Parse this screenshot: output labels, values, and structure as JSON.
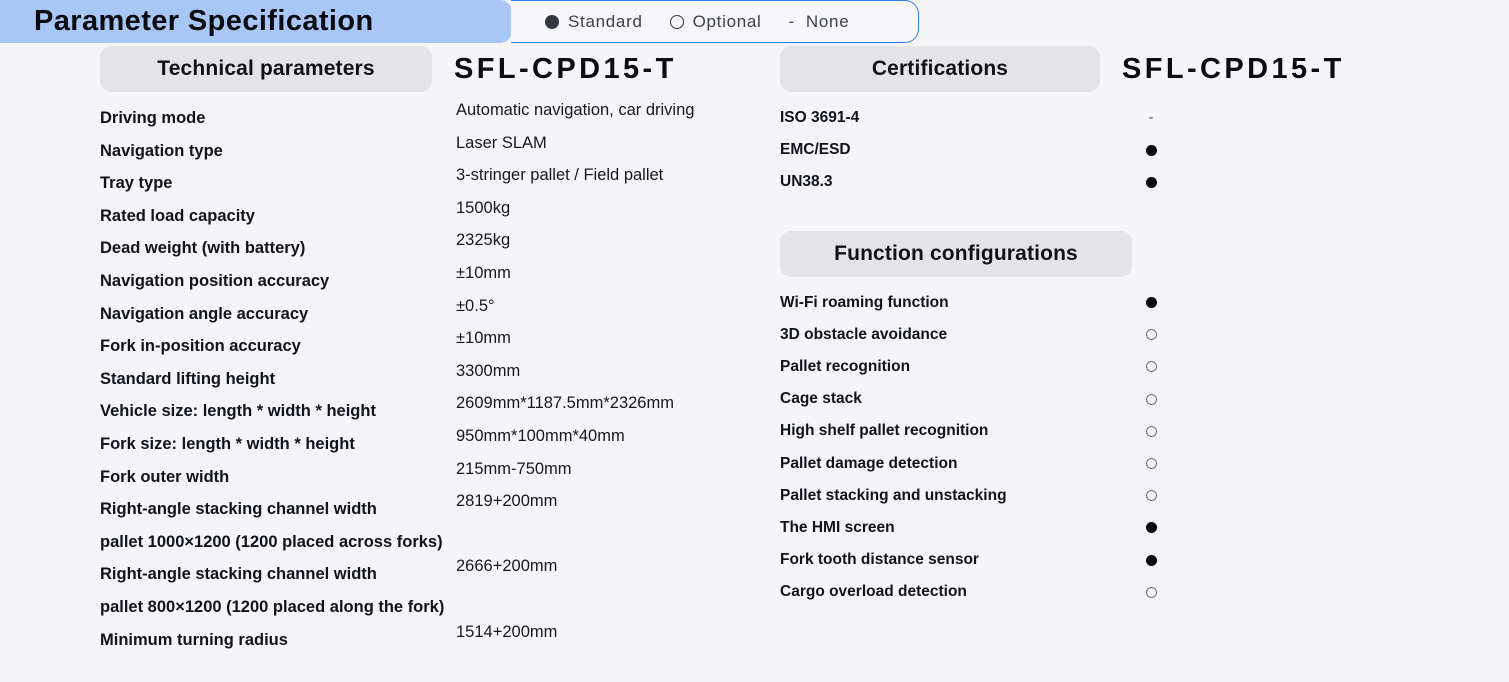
{
  "header": {
    "title": "Parameter Specification",
    "legend": [
      {
        "marker": "filled",
        "label": "Standard"
      },
      {
        "marker": "hollow",
        "label": "Optional"
      },
      {
        "marker": "dash",
        "label": "None"
      }
    ],
    "banner_color": "#a8c7f7",
    "legend_border_color": "#2f7cf0"
  },
  "technical": {
    "heading": "Technical parameters",
    "model": "SFL-CPD15-T",
    "rows": [
      {
        "label": "Driving mode",
        "value": "Automatic navigation, car driving"
      },
      {
        "label": "Navigation type",
        "value": "Laser SLAM"
      },
      {
        "label": "Tray type",
        "value": "3-stringer pallet / Field pallet"
      },
      {
        "label": "Rated load capacity",
        "value": "1500kg"
      },
      {
        "label": "Dead weight (with battery)",
        "value": "2325kg"
      },
      {
        "label": "Navigation position accuracy",
        "value": "±10mm"
      },
      {
        "label": "Navigation angle accuracy",
        "value": "±0.5°"
      },
      {
        "label": "Fork in-position accuracy",
        "value": "±10mm"
      },
      {
        "label": "Standard lifting height",
        "value": "3300mm"
      },
      {
        "label": "Vehicle size: length * width * height",
        "value": "2609mm*1187.5mm*2326mm"
      },
      {
        "label": "Fork size: length * width * height",
        "value": "950mm*100mm*40mm"
      },
      {
        "label": "Fork outer width",
        "value": "215mm-750mm"
      },
      {
        "label": "Right-angle stacking channel width",
        "value": "2819+200mm"
      },
      {
        "label": "pallet 1000×1200 (1200 placed across forks)",
        "value": ""
      },
      {
        "label": "Right-angle stacking channel width",
        "value": "2666+200mm"
      },
      {
        "label": "pallet 800×1200 (1200 placed along the fork)",
        "value": ""
      },
      {
        "label": "Minimum turning radius",
        "value": "1514+200mm"
      }
    ]
  },
  "certifications": {
    "heading": "Certifications",
    "model": "SFL-CPD15-T",
    "rows": [
      {
        "label": "ISO 3691-4",
        "marker": "none"
      },
      {
        "label": "EMC/ESD",
        "marker": "filled"
      },
      {
        "label": "UN38.3",
        "marker": "filled"
      }
    ]
  },
  "functions": {
    "heading": "Function configurations",
    "rows": [
      {
        "label": "Wi-Fi roaming function",
        "marker": "filled"
      },
      {
        "label": "3D obstacle avoidance",
        "marker": "hollow"
      },
      {
        "label": "Pallet recognition",
        "marker": "hollow"
      },
      {
        "label": "Cage stack",
        "marker": "hollow"
      },
      {
        "label": "High shelf pallet recognition",
        "marker": "hollow"
      },
      {
        "label": "Pallet damage detection",
        "marker": "hollow"
      },
      {
        "label": "Pallet stacking and unstacking",
        "marker": "hollow"
      },
      {
        "label": "The HMI screen",
        "marker": "filled"
      },
      {
        "label": "Fork tooth distance sensor",
        "marker": "filled"
      },
      {
        "label": "Cargo overload detection",
        "marker": "hollow"
      }
    ]
  }
}
